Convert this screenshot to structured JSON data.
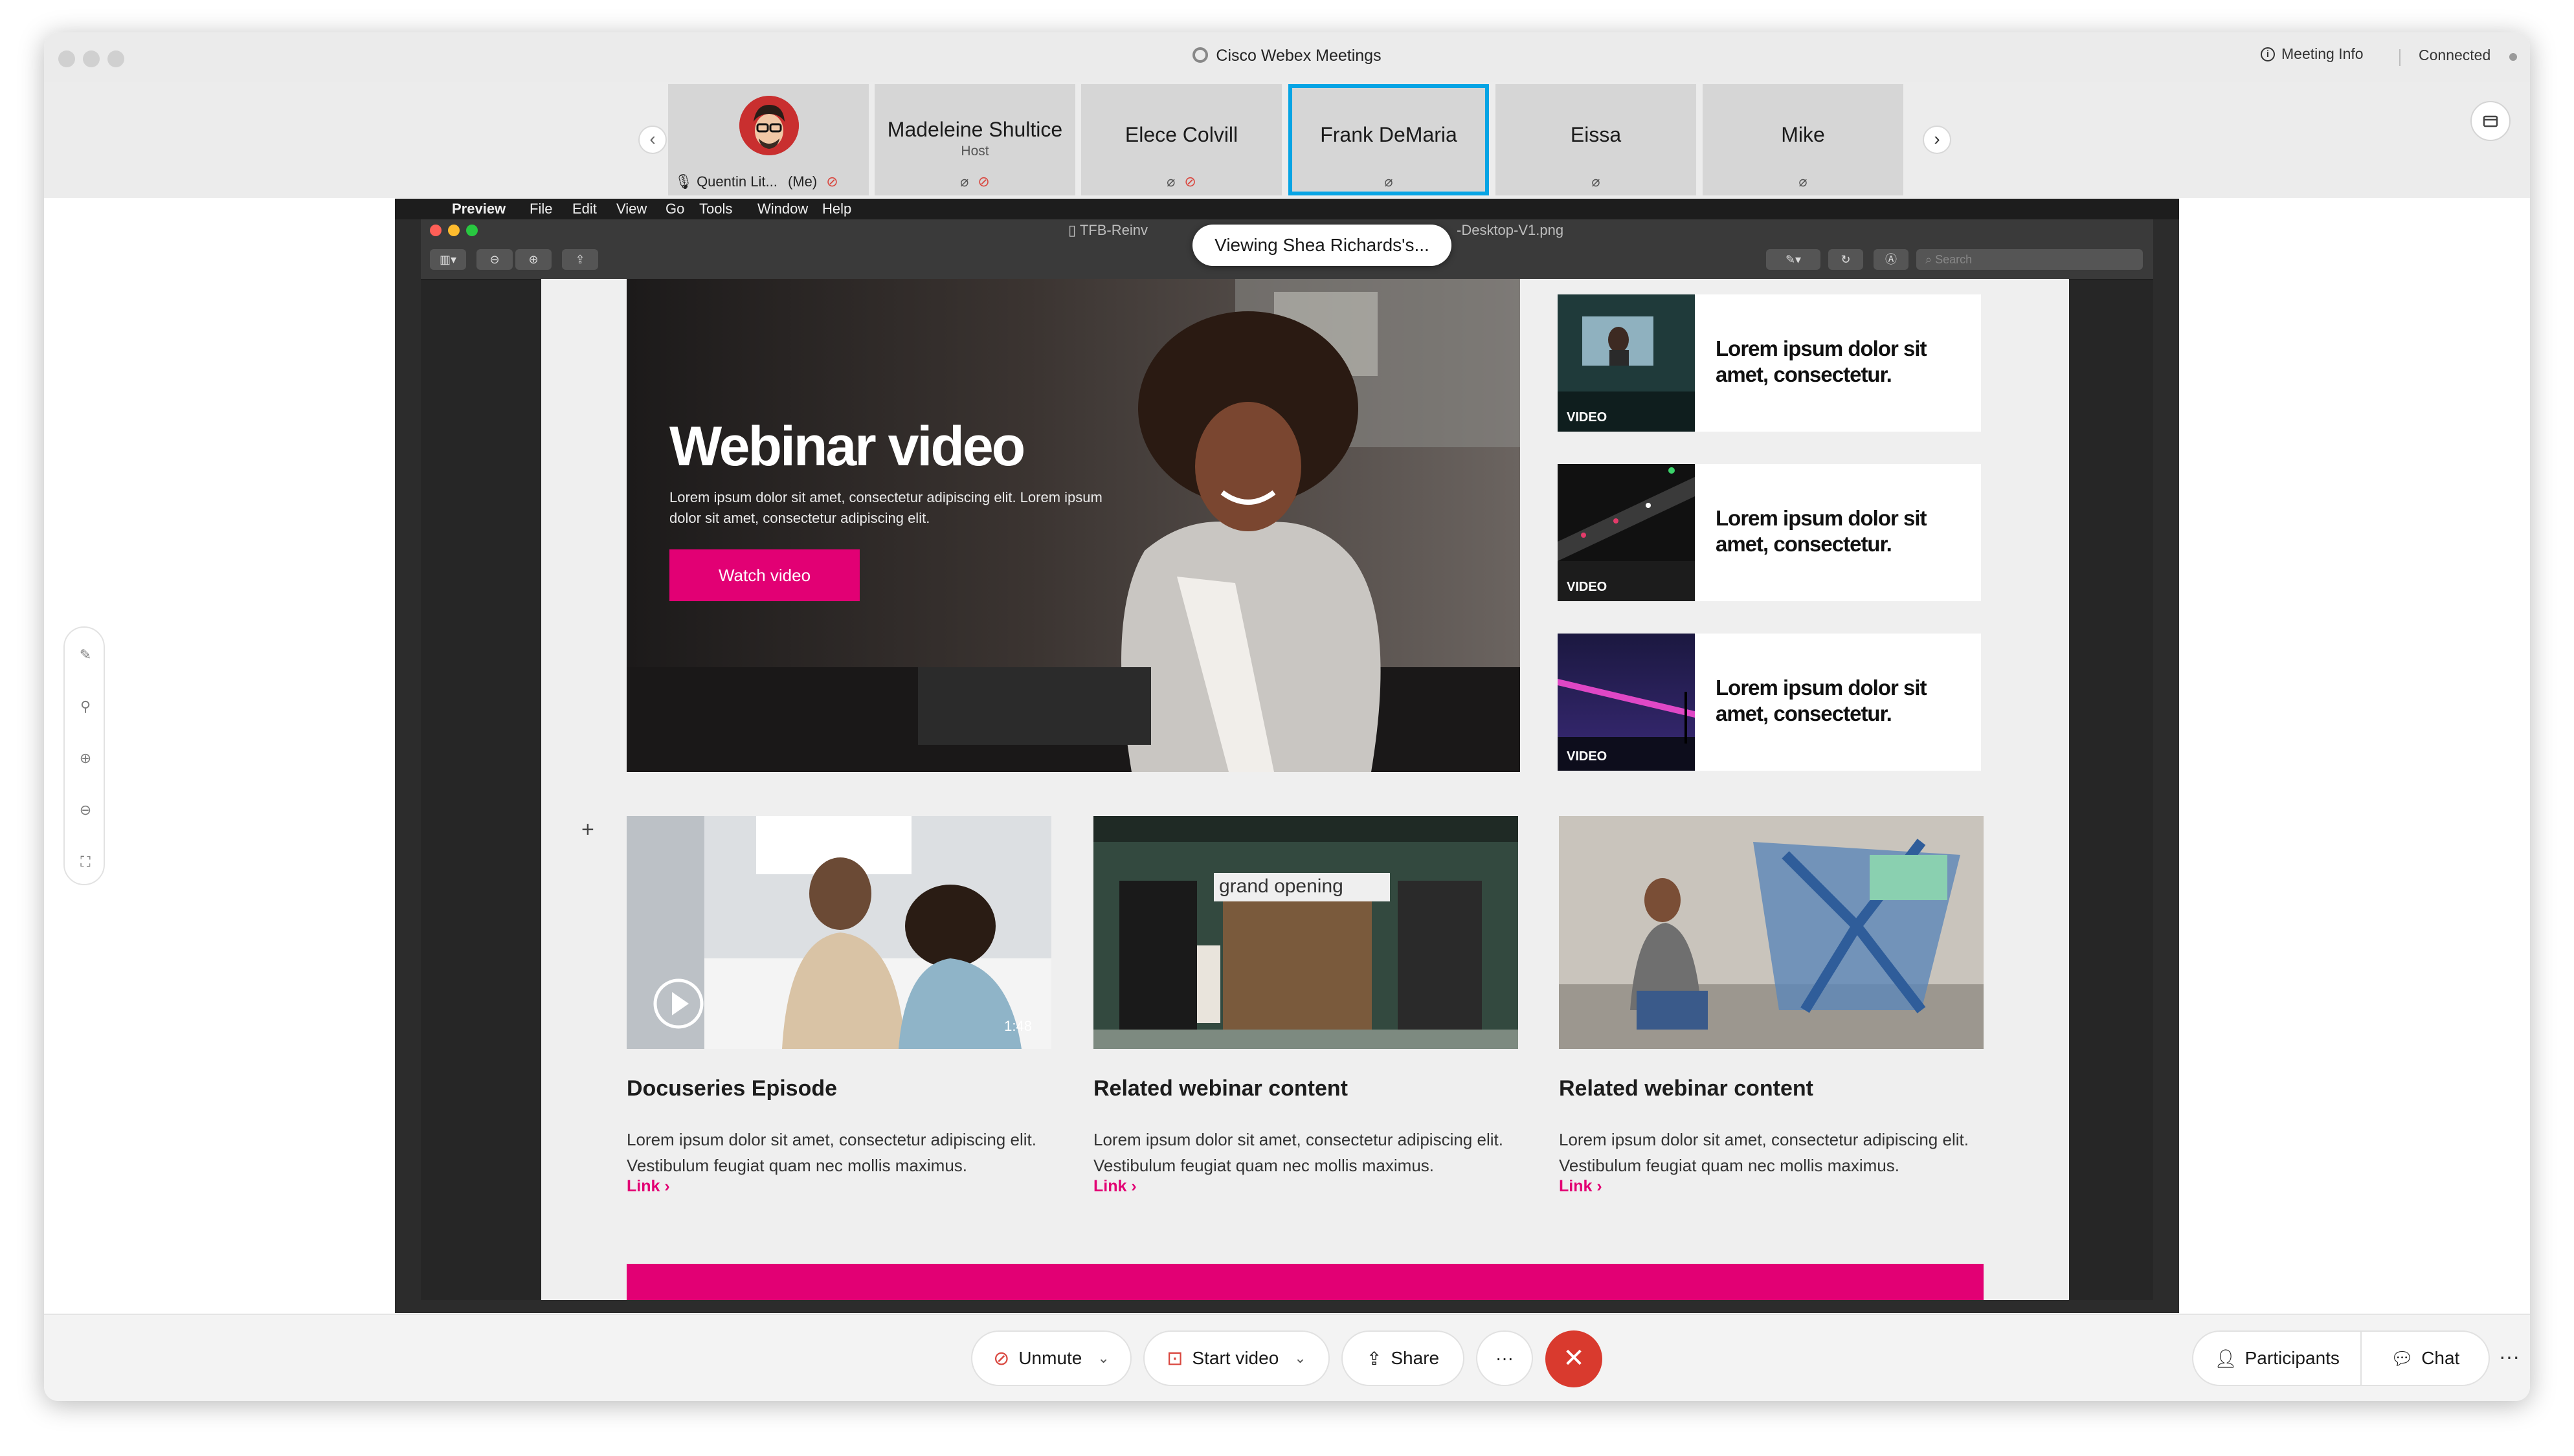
{
  "window": {
    "title": "Cisco Webex Meetings",
    "meeting_info": "Meeting Info",
    "status": "Connected"
  },
  "participants": [
    {
      "name": "Quentin Lit...",
      "suffix": "(Me)"
    },
    {
      "name": "Madeleine Shultice",
      "role": "Host"
    },
    {
      "name": "Elece Colvill"
    },
    {
      "name": "Frank DeMaria"
    },
    {
      "name": "Eissa"
    },
    {
      "name": "Mike"
    }
  ],
  "share": {
    "viewing_label": "Viewing Shea Richards's...",
    "mac_menu": [
      "Preview",
      "File",
      "Edit",
      "View",
      "Go",
      "Tools",
      "Window",
      "Help"
    ],
    "doc_title_left": "TFB-Reinv",
    "doc_title_right": "-Desktop-V1.png",
    "search_placeholder": "Search"
  },
  "webpage": {
    "hero": {
      "title": "Webinar video",
      "text": "Lorem ipsum dolor sit amet, consectetur adipiscing elit. Lorem ipsum dolor sit amet, consectetur adipiscing elit.",
      "button": "Watch video"
    },
    "video_cards": [
      {
        "tag": "VIDEO",
        "title": "Lorem ipsum dolor sit amet, consectetur."
      },
      {
        "tag": "VIDEO",
        "title": "Lorem ipsum dolor sit amet, consectetur."
      },
      {
        "tag": "VIDEO",
        "title": "Lorem ipsum dolor sit amet, consectetur."
      }
    ],
    "cards": [
      {
        "title": "Docuseries Episode",
        "desc": "Lorem ipsum dolor sit amet, consectetur adipiscing elit. Vestibulum feugiat quam nec mollis maximus.",
        "link": "Link",
        "duration": "1:48"
      },
      {
        "title": "Related webinar content",
        "desc": "Lorem ipsum dolor sit amet, consectetur adipiscing elit. Vestibulum feugiat quam nec mollis maximus.",
        "link": "Link",
        "sign": "grand opening"
      },
      {
        "title": "Related webinar content",
        "desc": "Lorem ipsum dolor sit amet, consectetur adipiscing elit. Vestibulum feugiat quam nec mollis maximus.",
        "link": "Link"
      }
    ],
    "accent_color": "#e20074"
  },
  "controls": {
    "unmute": "Unmute",
    "start_video": "Start video",
    "share": "Share",
    "more": "···",
    "participants": "Participants",
    "chat": "Chat"
  },
  "colors": {
    "active_tile_border": "#07a4e4",
    "end_call": "#d93a2e",
    "muted": "#d9463e"
  }
}
